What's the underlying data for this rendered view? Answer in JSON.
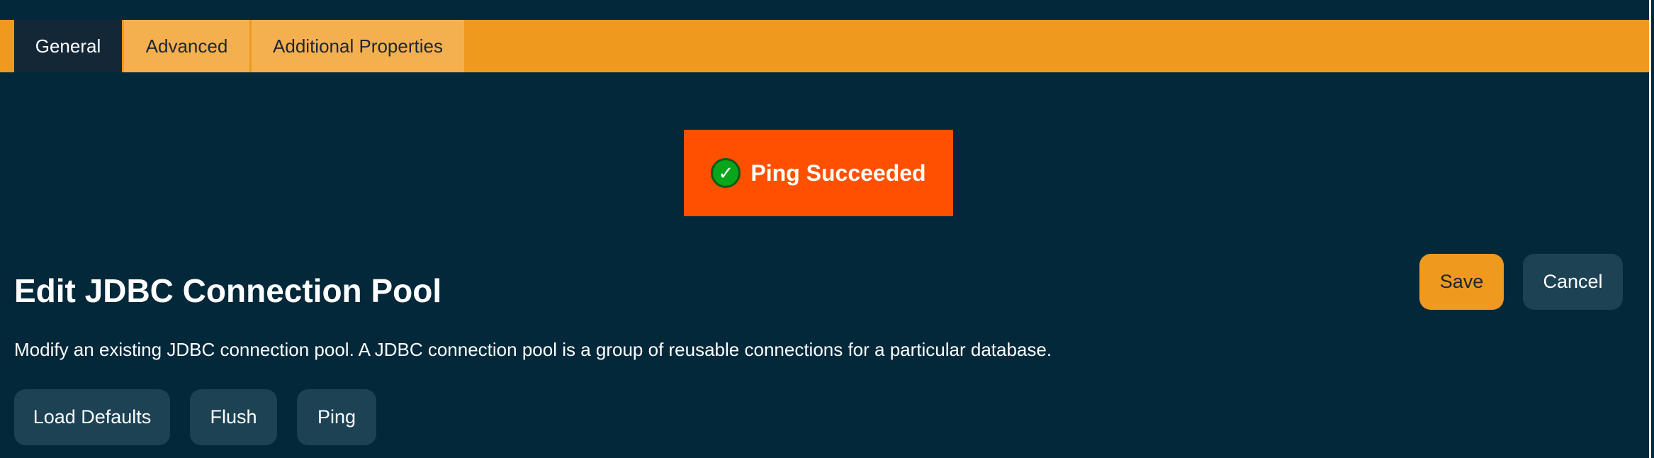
{
  "tabs": [
    {
      "label": "General",
      "active": true
    },
    {
      "label": "Advanced",
      "active": false
    },
    {
      "label": "Additional Properties",
      "active": false
    }
  ],
  "notification": {
    "message": "Ping Succeeded",
    "icon": "check-icon",
    "icon_glyph": "✓",
    "background_color": "#ff5000"
  },
  "page": {
    "title": "Edit JDBC Connection Pool",
    "description": "Modify an existing JDBC connection pool. A JDBC connection pool is a group of reusable connections for a particular database."
  },
  "actions": {
    "save_label": "Save",
    "cancel_label": "Cancel",
    "load_defaults_label": "Load Defaults",
    "flush_label": "Flush",
    "ping_label": "Ping"
  },
  "colors": {
    "background": "#02283a",
    "tab_bar": "#f0991f",
    "tab_active": "#142736",
    "tab_inactive": "#f4b04e",
    "button_primary": "#f0991f",
    "button_secondary": "#1d4254",
    "success_icon": "#09a51a"
  }
}
